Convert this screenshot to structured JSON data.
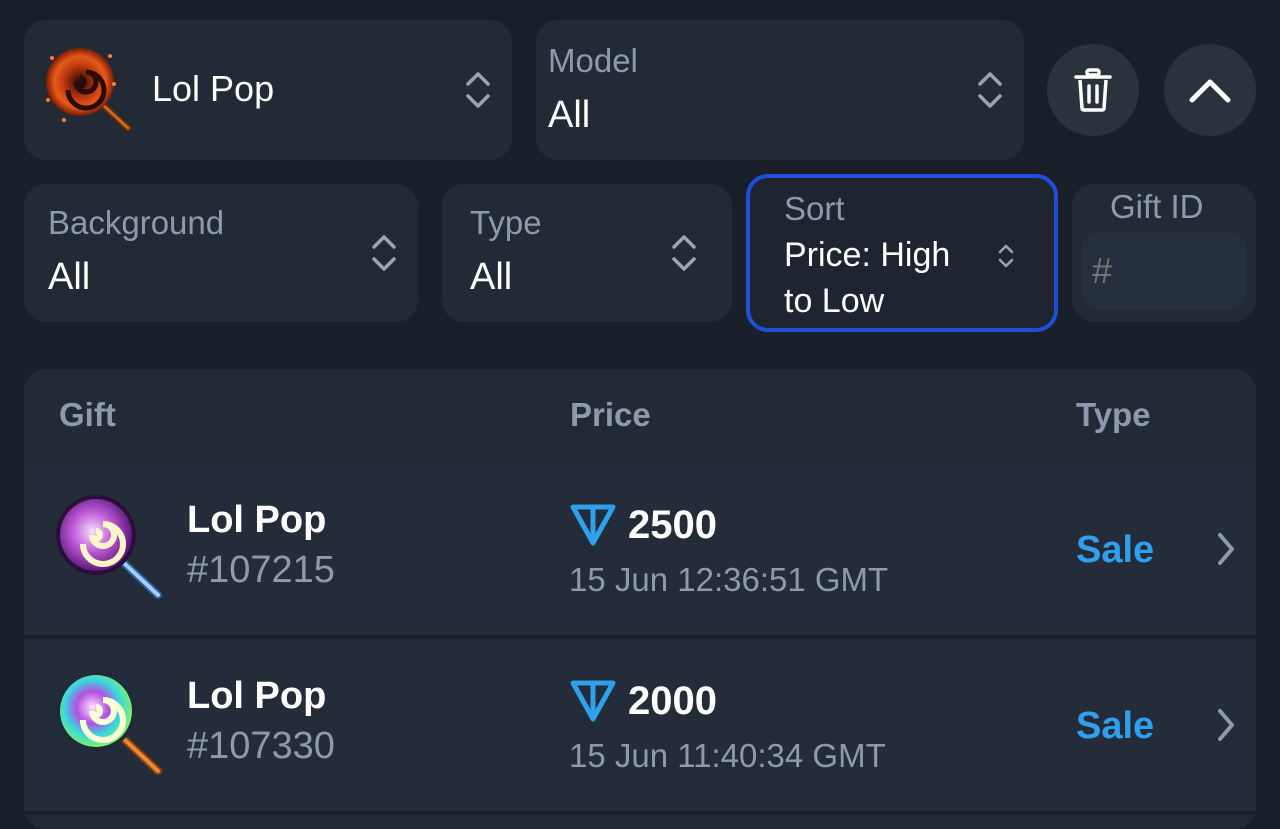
{
  "filters": {
    "gift": {
      "value": "Lol Pop",
      "icon": "lollipop-fire-icon"
    },
    "model": {
      "label": "Model",
      "value": "All"
    },
    "background": {
      "label": "Background",
      "value": "All"
    },
    "type": {
      "label": "Type",
      "value": "All"
    },
    "sort": {
      "label": "Sort",
      "value_line1": "Price: High",
      "value_line2": "to Low"
    },
    "gift_id": {
      "label": "Gift ID",
      "placeholder": "#"
    }
  },
  "table": {
    "columns": [
      "Gift",
      "Price",
      "Type"
    ],
    "rows": [
      {
        "name": "Lol Pop",
        "number": "#107215",
        "price": "2500",
        "date": "15 Jun 12:36:51 GMT",
        "type": "Sale"
      },
      {
        "name": "Lol Pop",
        "number": "#107330",
        "price": "2000",
        "date": "15 Jun 11:40:34 GMT",
        "type": "Sale"
      }
    ]
  },
  "colors": {
    "background": "#1a2029",
    "card": "#222a35",
    "muted": "#8e9aab",
    "accent": "#2ea0ec",
    "focus_border": "#1f4fd8"
  }
}
